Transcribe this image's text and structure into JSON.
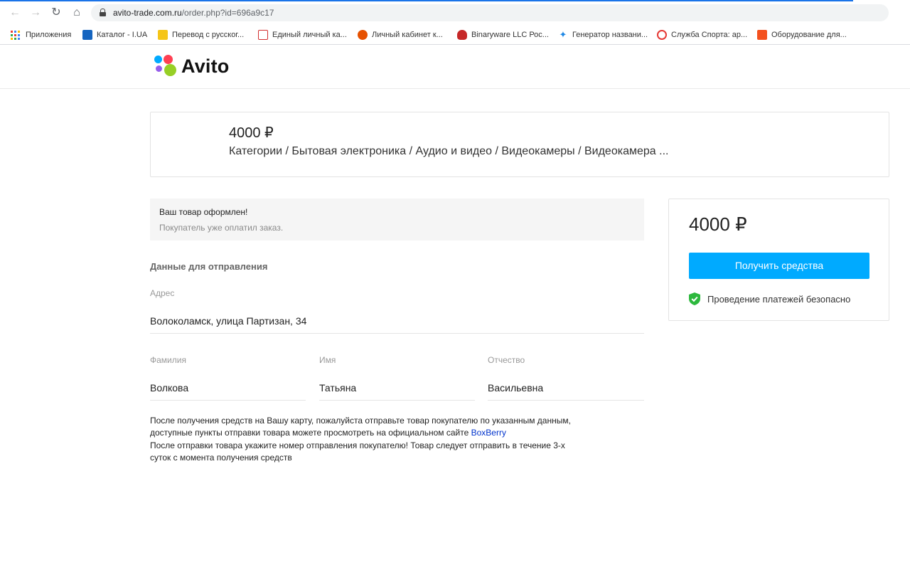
{
  "browser": {
    "url_host": "avito-trade.com.ru",
    "url_path": "/order.php?id=696a9c17",
    "bookmarks": [
      {
        "label": "Приложения",
        "icon": "apps-icon"
      },
      {
        "label": "Каталог - I.UA",
        "icon": "iua-icon",
        "color": "#1565c0"
      },
      {
        "label": "Перевод с русског...",
        "icon": "translate-icon",
        "color": "#f5c518"
      },
      {
        "label": "Единый личный ка...",
        "icon": "square-outline-icon",
        "color": "#d32f2f"
      },
      {
        "label": "Личный кабинет к...",
        "icon": "globe-icon",
        "color": "#e65100"
      },
      {
        "label": "Binaryware LLC Рос...",
        "icon": "binaryware-icon",
        "color": "#c62828"
      },
      {
        "label": "Генератор названи...",
        "icon": "leaf-icon",
        "color": "#1e88e5"
      },
      {
        "label": "Служба Спорта: ар...",
        "icon": "circle-icon",
        "color": "#e53935"
      },
      {
        "label": "Оборудование для...",
        "icon": "equipment-icon",
        "color": "#f4511e"
      }
    ]
  },
  "header": {
    "logo_text": "Avito"
  },
  "product": {
    "price": "4000 ₽",
    "category": "Категории / Бытовая электроника / Аудио и видео / Видеокамеры / Видеокамера ..."
  },
  "notice": {
    "title": "Ваш товар оформлен!",
    "subtitle": "Покупатель уже оплатил заказ."
  },
  "shipping": {
    "section_title": "Данные для отправления",
    "address_label": "Адрес",
    "address_value": "Волоколамск, улица Партизан, 34",
    "last_name_label": "Фамилия",
    "last_name_value": "Волкова",
    "first_name_label": "Имя",
    "first_name_value": "Татьяна",
    "patronymic_label": "Отчество",
    "patronymic_value": "Васильевна"
  },
  "info": {
    "line1": "После получения средств на Вашу карту, пожалуйста отправьте товар покупателю по указанным данным,",
    "line2": "доступные пункты отправки товара можете просмотреть на официальном сайте ",
    "link": "BoxBerry",
    "line3": "После отправки товара укажите номер отправления покупателю! Товар следует отправить в течение 3-х",
    "line4": "суток с момента получения средств"
  },
  "payment": {
    "price": "4000 ₽",
    "button_label": "Получить средства",
    "secure_text": "Проведение платежей безопасно"
  },
  "colors": {
    "accent": "#00aaff",
    "secure_green": "#2db83d",
    "link": "#0033cc"
  }
}
